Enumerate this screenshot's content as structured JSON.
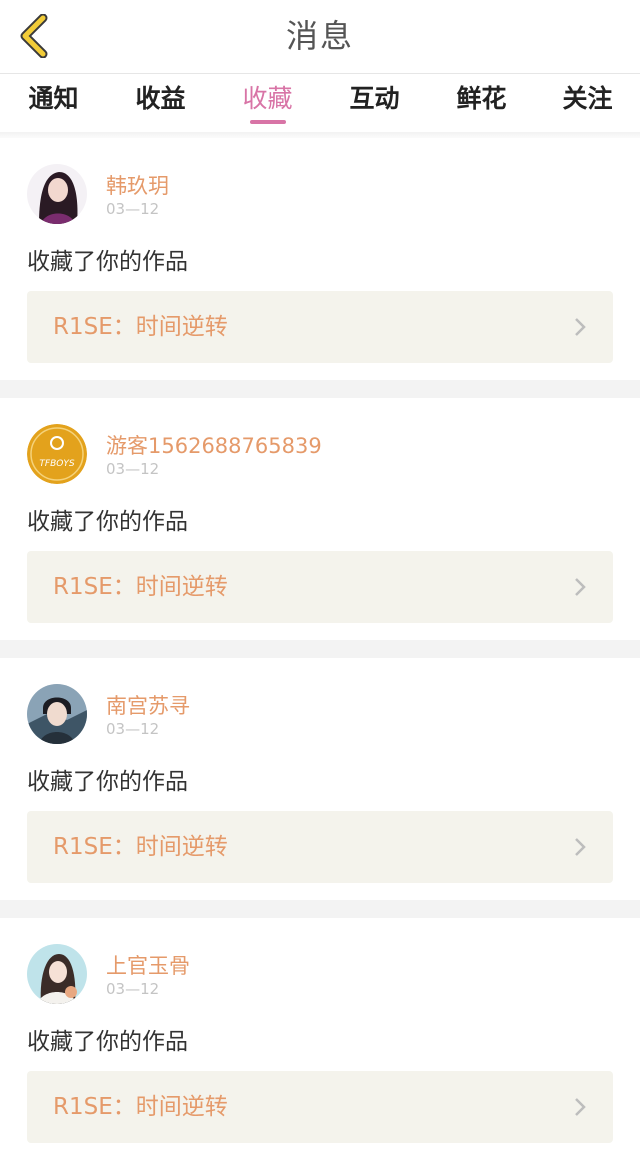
{
  "header": {
    "title": "消息",
    "back_icon": "chevron-left-icon",
    "back_color": "#f2cc38"
  },
  "tabs": [
    {
      "label": "通知"
    },
    {
      "label": "收益"
    },
    {
      "label": "收藏",
      "active": true
    },
    {
      "label": "互动"
    },
    {
      "label": "鲜花"
    },
    {
      "label": "关注"
    }
  ],
  "accent_color": "#d874a6",
  "name_color": "#e59a6a",
  "items": [
    {
      "user": "韩玖玥",
      "date": "03—12",
      "action": "收藏了你的作品",
      "work": "R1SE：时间逆转",
      "avatar": "avatar-girl"
    },
    {
      "user": "游客1562688765839",
      "date": "03—12",
      "action": "收藏了你的作品",
      "work": "R1SE：时间逆转",
      "avatar": "avatar-tfboys",
      "avatar_text": "TFBOYS"
    },
    {
      "user": "南宫苏寻",
      "date": "03—12",
      "action": "收藏了你的作品",
      "work": "R1SE：时间逆转",
      "avatar": "avatar-man"
    },
    {
      "user": "上官玉骨",
      "date": "03—12",
      "action": "收藏了你的作品",
      "work": "R1SE：时间逆转",
      "avatar": "avatar-woman"
    }
  ]
}
